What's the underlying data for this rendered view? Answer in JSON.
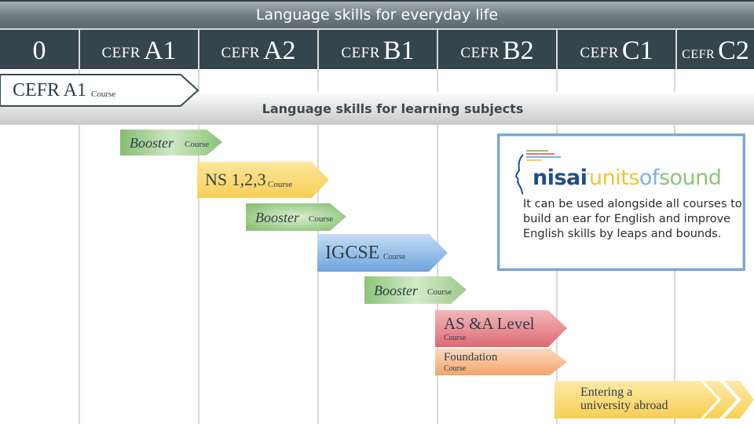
{
  "top_band": {
    "title": "Language skills for everyday life"
  },
  "levels": [
    {
      "prefix": "",
      "level": "0"
    },
    {
      "prefix": "CEFR",
      "level": "A1"
    },
    {
      "prefix": "CEFR",
      "level": "A2"
    },
    {
      "prefix": "CEFR",
      "level": "B1"
    },
    {
      "prefix": "CEFR",
      "level": "B2"
    },
    {
      "prefix": "CEFR",
      "level": "C1"
    },
    {
      "prefix": "CEFR",
      "level": "C2"
    }
  ],
  "band2": {
    "title": "Language skills for learning subjects"
  },
  "courses": {
    "cefr_a1": {
      "title": "CEFR A1",
      "sub": "Course"
    },
    "booster1": {
      "title": "Booster",
      "sub": "Course"
    },
    "ns": {
      "title": "NS 1,2,3",
      "sub": "Course"
    },
    "booster2": {
      "title": "Booster",
      "sub": "Course"
    },
    "igcse": {
      "title": "IGCSE",
      "sub": "Course"
    },
    "booster3": {
      "title": "Booster",
      "sub": "Course"
    },
    "alevel": {
      "title": "AS &A Level",
      "sub": "Course"
    },
    "foundation": {
      "title": "Foundation",
      "sub": "Course"
    },
    "university": {
      "line1": "Entering a",
      "line2": "university abroad"
    }
  },
  "info": {
    "logo_nisai": "nisai",
    "logo_units": "units",
    "logo_of": "of",
    "logo_sound": "sound",
    "text": "It can be used alongside all courses to build an ear for English and improve English skills by leaps and bounds."
  },
  "colors": {
    "header_dark": "#35454d",
    "green": "#8cc47a",
    "yellow": "#fbd766",
    "blue": "#7fb0e3",
    "red": "#e2747c",
    "orange": "#f5b17f",
    "box_border": "#7aa6d8"
  }
}
